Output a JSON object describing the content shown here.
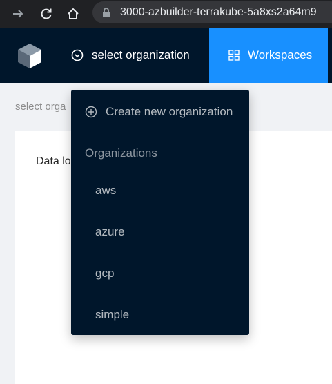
{
  "browser": {
    "url": "3000-azbuilder-terrakube-5a8xs2a64m9"
  },
  "header": {
    "org_selector_label": "select organization",
    "workspaces_label": "Workspaces"
  },
  "main": {
    "breadcrumb": "select orga",
    "card_text": "Data lo"
  },
  "dropdown": {
    "create_label": "Create new organization",
    "group_title": "Organizations",
    "items": [
      "aws",
      "azure",
      "gcp",
      "simple"
    ]
  },
  "colors": {
    "header_bg": "#00162b",
    "accent": "#1890ff"
  },
  "icons": {
    "back": "arrow-right-icon",
    "reload": "reload-icon",
    "home": "home-icon",
    "lock": "lock-icon",
    "logo": "cube-logo-icon",
    "org": "clock-icon",
    "workspaces": "grid-icon",
    "create": "plus-circle-icon"
  }
}
